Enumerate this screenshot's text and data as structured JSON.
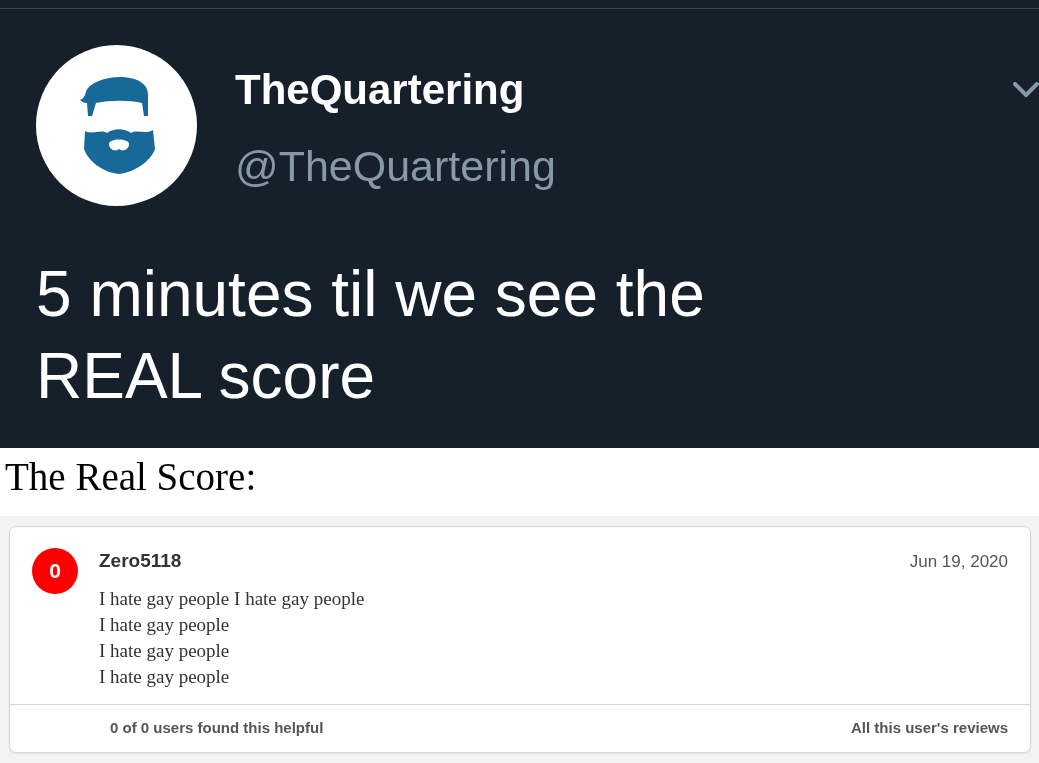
{
  "tweet": {
    "author": {
      "name": "TheQuartering",
      "handle": "@TheQuartering"
    },
    "text": "5 minutes til we see the REAL score"
  },
  "caption": "The Real Score:",
  "review": {
    "score": "0",
    "username": "Zero5118",
    "date": "Jun 19, 2020",
    "body": "I hate gay people I hate gay people\nI hate gay people\nI hate gay people\nI hate gay people",
    "helpful": "0 of 0 users found this helpful",
    "reviews_link": "All this user's reviews"
  }
}
